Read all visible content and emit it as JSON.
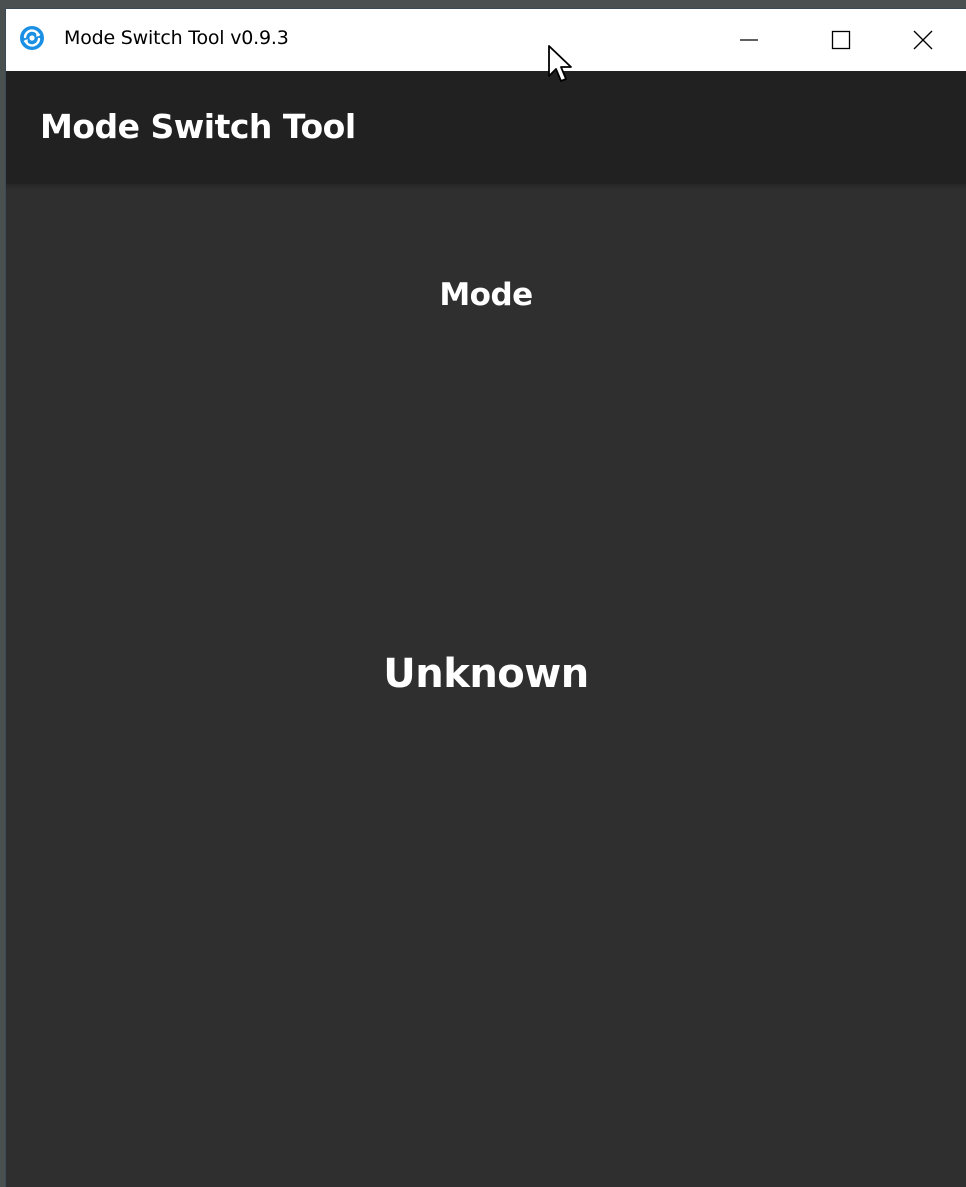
{
  "window": {
    "title": "Mode Switch Tool v0.9.3",
    "app_icon": "refresh-eye-icon",
    "controls": {
      "minimize_icon": "minimize-icon",
      "maximize_icon": "maximize-icon",
      "close_icon": "close-icon"
    }
  },
  "header": {
    "title": "Mode Switch Tool"
  },
  "main": {
    "mode_label": "Mode",
    "mode_value": "Unknown"
  },
  "colors": {
    "titlebar_bg": "#ffffff",
    "header_bg": "#212121",
    "content_bg": "#2f2f2f",
    "icon_accent": "#1a8fe3",
    "text": "#ffffff"
  }
}
